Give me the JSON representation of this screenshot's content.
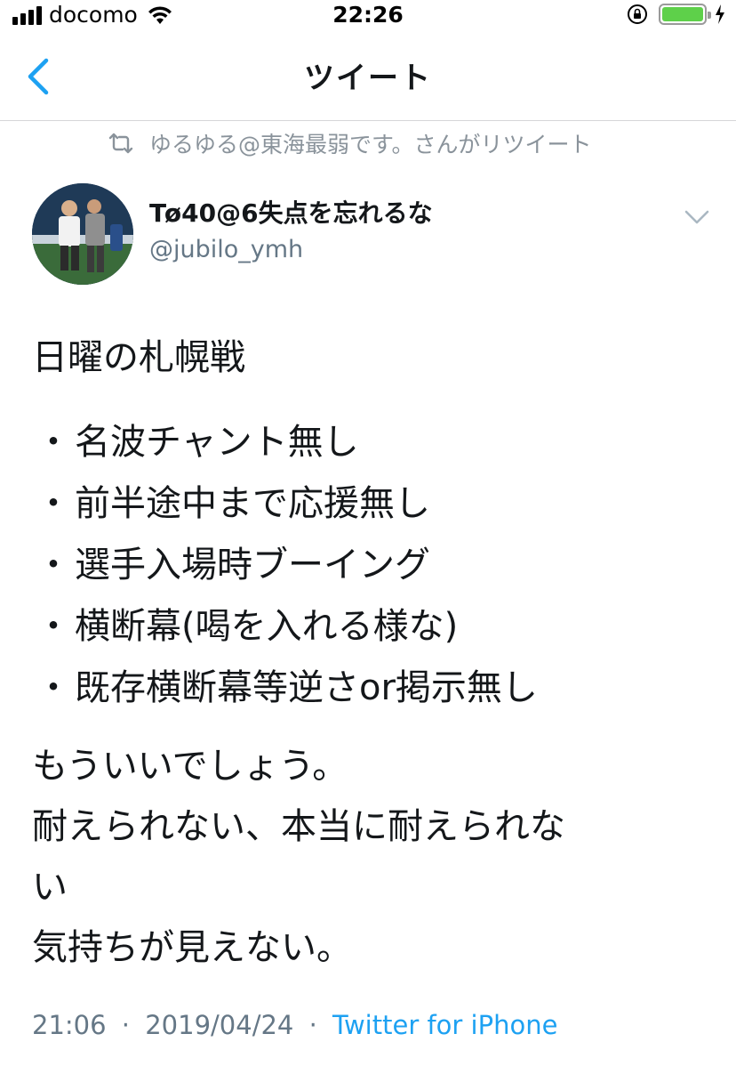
{
  "status_bar": {
    "carrier": "docomo",
    "time": "22:26",
    "battery_color": "#5ed04a"
  },
  "nav": {
    "title": "ツイート",
    "back_icon": "chevron-left-icon"
  },
  "retweet_context": {
    "icon": "retweet-icon",
    "text": "ゆるゆる@東海最弱です。さんがリツイート"
  },
  "author": {
    "display_name": "Tø40@6失点を忘れるな",
    "handle": "@jubilo_ymh"
  },
  "tweet": {
    "heading": "日曜の札幌戦",
    "bullets": [
      "名波チャント無し",
      "前半途中まで応援無し",
      "選手入場時ブーイング",
      "横断幕(喝を入れる様な)",
      "既存横断幕等逆さor掲示無し"
    ],
    "bullet_mark": "・",
    "closing_lines": [
      "もういいでしょう。",
      "耐えられない、本当に耐えられな",
      "い",
      "気持ちが見えない。"
    ]
  },
  "meta": {
    "time": "21:06",
    "separator": "·",
    "date": "2019/04/24",
    "source": "Twitter for iPhone",
    "link_color": "#1da1f2"
  }
}
